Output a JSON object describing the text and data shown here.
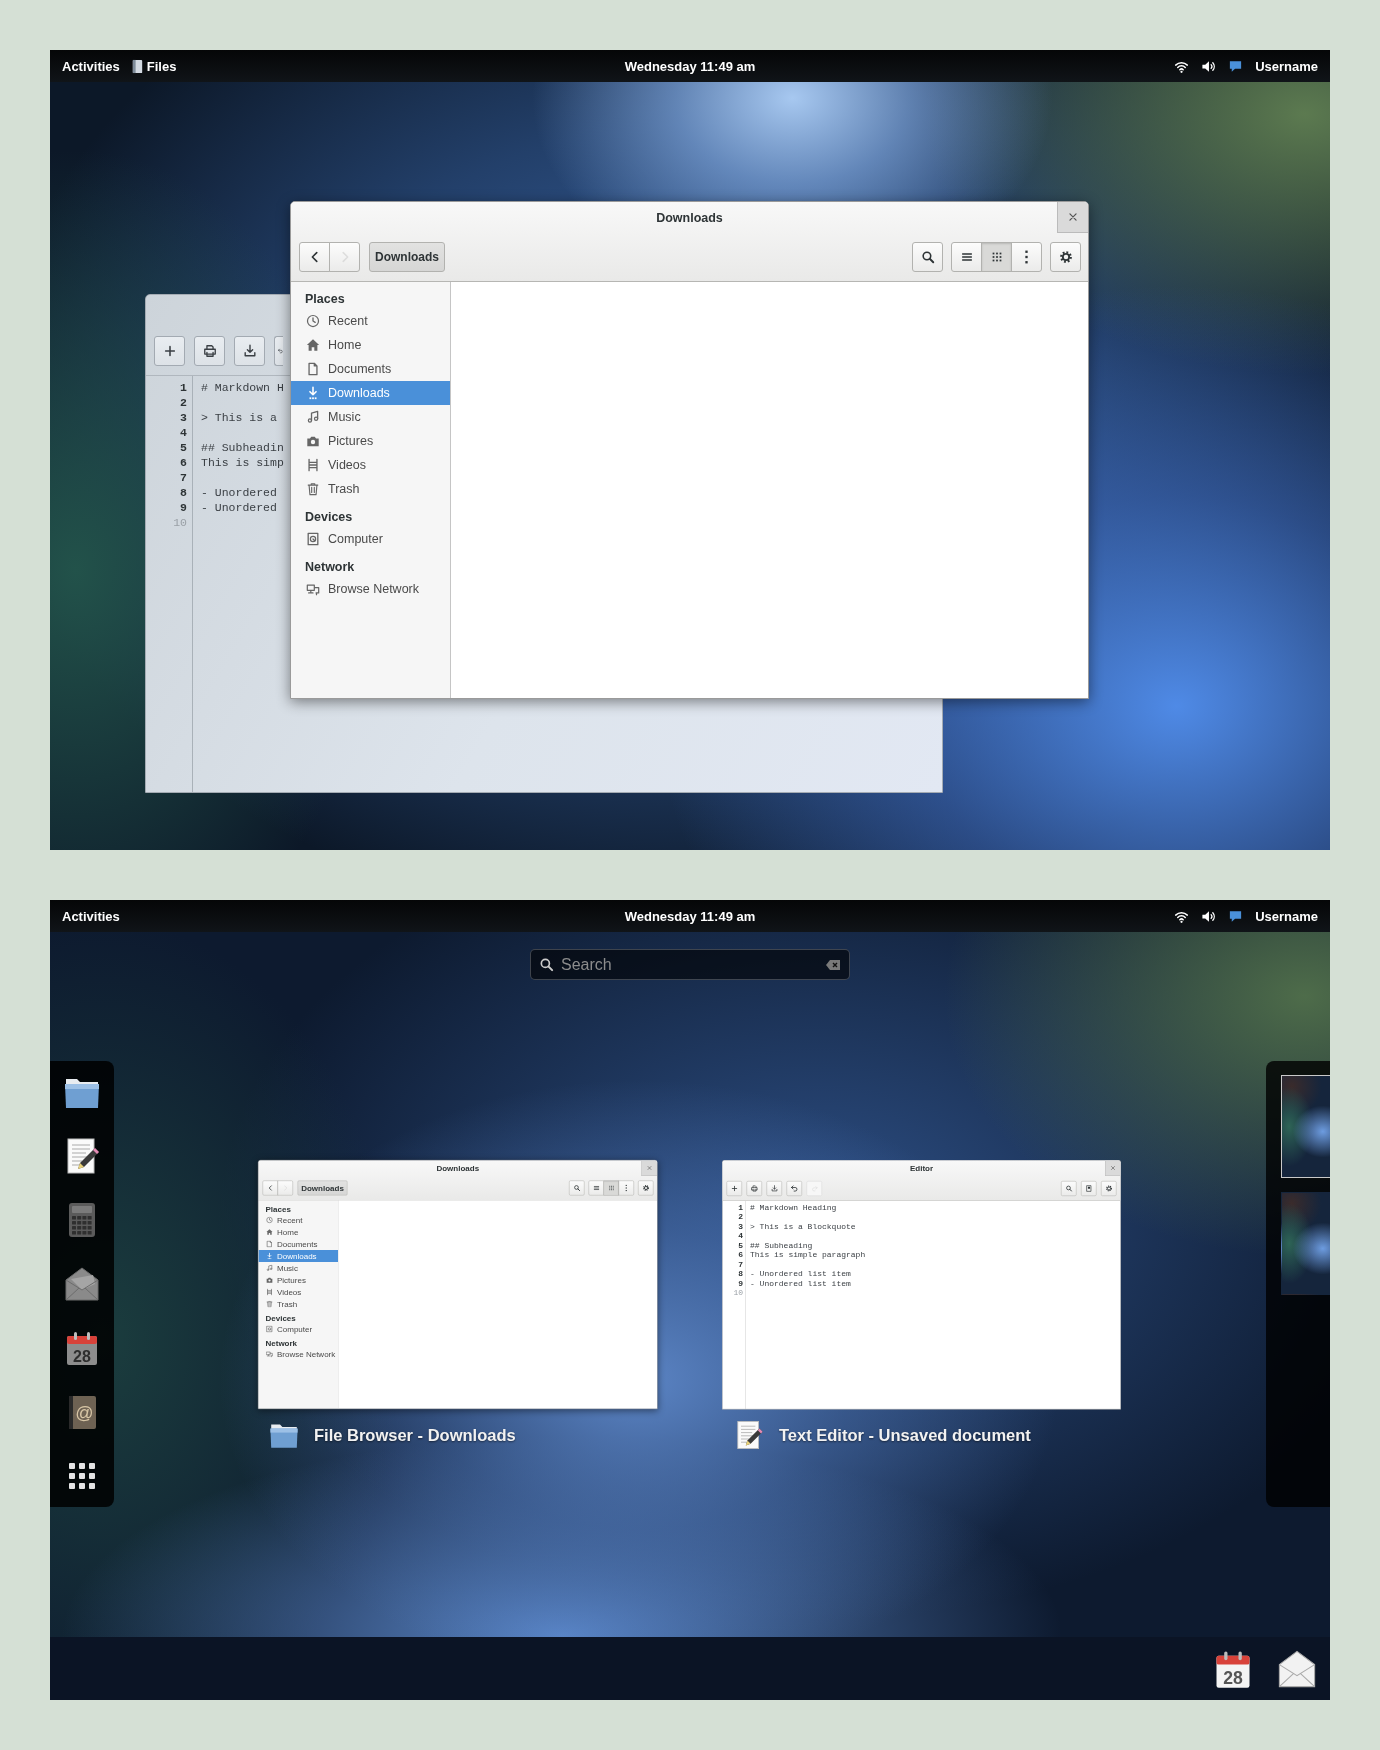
{
  "desktop": {
    "top_bar": {
      "activities": "Activities",
      "app_name": "Files",
      "clock": "Wednesday 11:49 am",
      "user": "Username"
    },
    "editor_window": {
      "toolbar": [
        {
          "kind": "new",
          "disabled": false
        },
        {
          "kind": "open",
          "disabled": false
        },
        {
          "kind": "save",
          "disabled": false
        },
        {
          "kind": "undo",
          "disabled": false
        }
      ],
      "lines": [
        {
          "number": "1",
          "text": "# Markdown H",
          "dimmed": false
        },
        {
          "number": "2",
          "dimmed": false
        },
        {
          "number": "3",
          "text": "> This is a",
          "dimmed": false
        },
        {
          "number": "4",
          "dimmed": false
        },
        {
          "number": "5",
          "text": "## Subheadin",
          "dimmed": false
        },
        {
          "number": "6",
          "text": "This is simp",
          "dimmed": false
        },
        {
          "number": "7",
          "dimmed": false
        },
        {
          "number": "8",
          "text": "- Unordered",
          "dimmed": false
        },
        {
          "number": "9",
          "text": "- Unordered",
          "dimmed": false
        },
        {
          "number": "10",
          "dimmed": true
        }
      ]
    },
    "files_window": {
      "title": "Downloads",
      "nav": [
        {
          "kind": "back",
          "disabled": false
        },
        {
          "kind": "forward",
          "disabled": true
        }
      ],
      "path": "Downloads",
      "view_buttons": [
        {
          "kind": "list",
          "selected": false
        },
        {
          "kind": "grid",
          "selected": true
        },
        {
          "kind": "more",
          "selected": false
        }
      ],
      "sidebar": [
        {
          "heading": "Places",
          "items": [
            {
              "kind": "recent",
              "label": "Recent",
              "selected": false
            },
            {
              "kind": "home",
              "label": "Home",
              "selected": false
            },
            {
              "kind": "documents",
              "label": "Documents",
              "selected": false
            },
            {
              "kind": "downloads",
              "label": "Downloads",
              "selected": true
            },
            {
              "kind": "music",
              "label": "Music",
              "selected": false
            },
            {
              "kind": "pictures",
              "label": "Pictures",
              "selected": false
            },
            {
              "kind": "videos",
              "label": "Videos",
              "selected": false
            },
            {
              "kind": "trash",
              "label": "Trash",
              "selected": false
            }
          ]
        },
        {
          "heading": "Devices",
          "items": [
            {
              "kind": "computer",
              "label": "Computer",
              "selected": false
            }
          ]
        },
        {
          "heading": "Network",
          "items": [
            {
              "kind": "network",
              "label": "Browse Network",
              "selected": false
            }
          ]
        }
      ]
    }
  },
  "overview": {
    "top_bar": {
      "activities": "Activities",
      "clock": "Wednesday 11:49 am",
      "user": "Username"
    },
    "search": {
      "placeholder": "Search"
    },
    "dash": [
      {
        "kind": "files"
      },
      {
        "kind": "editor"
      },
      {
        "kind": "calculator"
      },
      {
        "kind": "mail"
      },
      {
        "kind": "calendar",
        "text": "28"
      },
      {
        "kind": "contacts",
        "text": "@"
      },
      {
        "kind": "apps"
      }
    ],
    "windows": [
      {
        "kind": "files",
        "caption": "File Browser - Downloads",
        "window": {
          "title": "Downloads",
          "nav": [
            {
              "kind": "back",
              "disabled": false
            },
            {
              "kind": "forward",
              "disabled": true
            }
          ],
          "path": "Downloads",
          "view_buttons": [
            {
              "kind": "list",
              "selected": false
            },
            {
              "kind": "grid",
              "selected": true
            },
            {
              "kind": "more",
              "selected": false
            }
          ],
          "sidebar": [
            {
              "heading": "Places",
              "items": [
                {
                  "kind": "recent",
                  "label": "Recent",
                  "selected": false
                },
                {
                  "kind": "home",
                  "label": "Home",
                  "selected": false
                },
                {
                  "kind": "documents",
                  "label": "Documents",
                  "selected": false
                },
                {
                  "kind": "downloads",
                  "label": "Downloads",
                  "selected": true
                },
                {
                  "kind": "music",
                  "label": "Music",
                  "selected": false
                },
                {
                  "kind": "pictures",
                  "label": "Pictures",
                  "selected": false
                },
                {
                  "kind": "videos",
                  "label": "Videos",
                  "selected": false
                },
                {
                  "kind": "trash",
                  "label": "Trash",
                  "selected": false
                }
              ]
            },
            {
              "heading": "Devices",
              "items": [
                {
                  "kind": "computer",
                  "label": "Computer",
                  "selected": false
                }
              ]
            },
            {
              "heading": "Network",
              "items": [
                {
                  "kind": "network",
                  "label": "Browse Network",
                  "selected": false
                }
              ]
            }
          ]
        }
      },
      {
        "kind": "editor",
        "caption": "Text Editor - Unsaved document",
        "window": {
          "title": "Editor",
          "toolbar": [
            {
              "kind": "new",
              "disabled": false
            },
            {
              "kind": "open",
              "disabled": false
            },
            {
              "kind": "save",
              "disabled": false
            },
            {
              "kind": "undo",
              "disabled": false
            },
            {
              "kind": "redo",
              "disabled": true
            }
          ],
          "toolbar_right": [
            {
              "kind": "search"
            },
            {
              "kind": "page"
            },
            {
              "kind": "settings"
            }
          ],
          "lines": [
            {
              "number": "1",
              "text": "# Markdown Heading",
              "dimmed": false
            },
            {
              "number": "2",
              "dimmed": false
            },
            {
              "number": "3",
              "text": "> This is a Blockquote",
              "dimmed": false
            },
            {
              "number": "4",
              "dimmed": false
            },
            {
              "number": "5",
              "text": "## Subheading",
              "dimmed": false
            },
            {
              "number": "6",
              "text": "This is simple paragraph",
              "dimmed": false
            },
            {
              "number": "7",
              "dimmed": false
            },
            {
              "number": "8",
              "text": "- Unordered list item",
              "dimmed": false
            },
            {
              "number": "9",
              "text": "- Unordered list item",
              "dimmed": false
            },
            {
              "number": "10",
              "dimmed": true
            }
          ]
        }
      }
    ],
    "workspaces": [
      {
        "selected": true
      },
      {
        "selected": false
      }
    ],
    "tray": [
      {
        "kind": "calendar",
        "text": "28"
      },
      {
        "kind": "mail"
      }
    ]
  }
}
